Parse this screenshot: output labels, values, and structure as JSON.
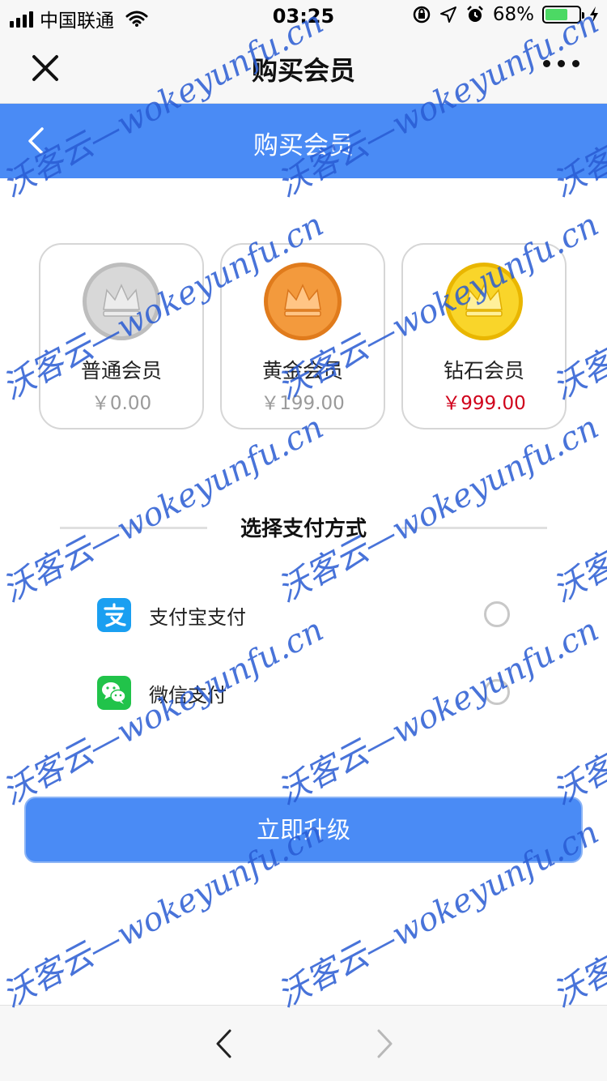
{
  "status_bar": {
    "carrier": "中国联通",
    "time": "03:25",
    "battery_percent": "68%",
    "battery_level": 0.68
  },
  "wechat_nav": {
    "title": "购买会员",
    "close_icon": "close-icon",
    "more_icon": "more-dots-icon"
  },
  "header": {
    "title": "购买会员",
    "back_icon": "chevron-left-icon"
  },
  "members": [
    {
      "name": "普通会员",
      "price": "￥0.00",
      "coin_color": "#c9c9c9",
      "coin_icon": "silver-crown-coin-icon"
    },
    {
      "name": "黄金会员",
      "price": "￥199.00",
      "coin_color": "#f08a2a",
      "coin_icon": "orange-crown-coin-icon"
    },
    {
      "name": "钻石会员",
      "price": "￥999.00",
      "coin_color": "#f7cf1c",
      "coin_icon": "gold-crown-coin-icon"
    }
  ],
  "payment": {
    "section_title": "选择支付方式",
    "options": [
      {
        "label": "支付宝支付",
        "icon": "alipay-icon",
        "selected": false
      },
      {
        "label": "微信支付",
        "icon": "wechat-pay-icon",
        "selected": false
      }
    ]
  },
  "upgrade_button": {
    "label": "立即升级"
  },
  "bottom_bar": {
    "back_icon": "chevron-left-icon",
    "forward_icon": "chevron-right-icon"
  },
  "watermark": {
    "text": "沃客云—wokeyunfu.cn"
  },
  "colors": {
    "accent": "#4a8bf5",
    "price_highlight": "#d0021b",
    "alipay": "#1a9ff1",
    "wechat": "#21c34a"
  }
}
